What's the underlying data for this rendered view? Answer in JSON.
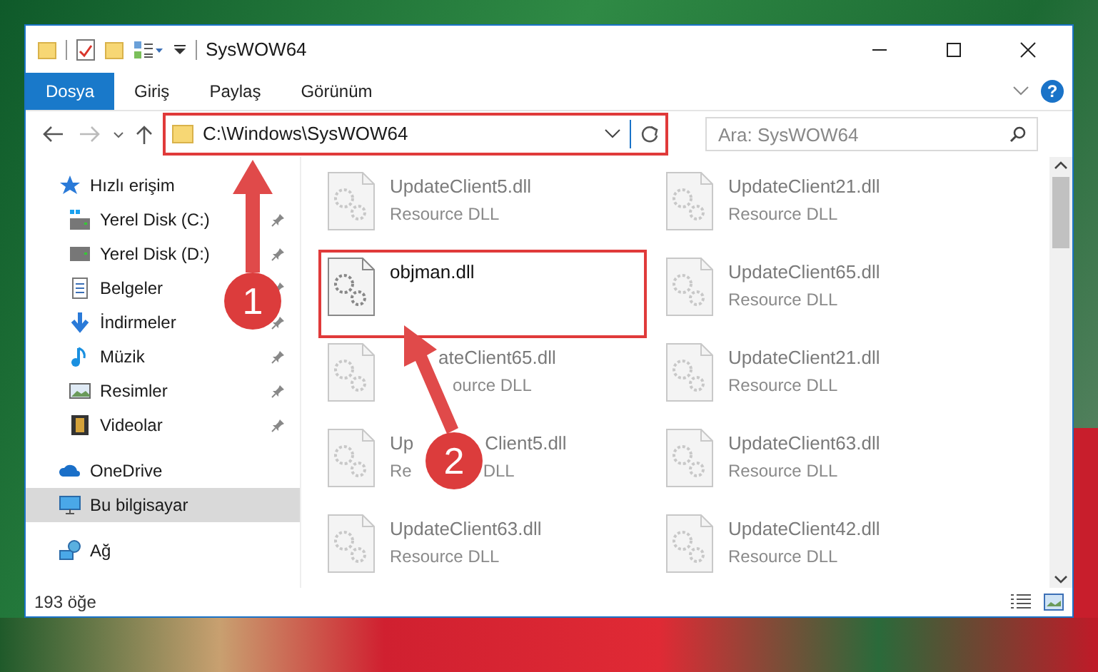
{
  "window": {
    "title": "SysWOW64"
  },
  "ribbon": {
    "tabs": [
      {
        "label": "Dosya",
        "selected": true
      },
      {
        "label": "Giriş",
        "selected": false
      },
      {
        "label": "Paylaş",
        "selected": false
      },
      {
        "label": "Görünüm",
        "selected": false
      }
    ],
    "help_label": "?"
  },
  "address_bar": {
    "path": "C:\\Windows\\SysWOW64",
    "highlighted": true
  },
  "search": {
    "placeholder": "Ara: SysWOW64"
  },
  "sidebar": {
    "items": [
      {
        "label": "Hızlı erişim",
        "kind": "star",
        "selected": false,
        "children": [
          {
            "label": "Yerel Disk (C:)",
            "kind": "drive-win",
            "pinned": true,
            "selected": false
          },
          {
            "label": "Yerel Disk (D:)",
            "kind": "drive",
            "pinned": true,
            "selected": false
          },
          {
            "label": "Belgeler",
            "kind": "doc",
            "pinned": true,
            "selected": false
          },
          {
            "label": "İndirmeler",
            "kind": "download",
            "pinned": true,
            "selected": false
          },
          {
            "label": "Müzik",
            "kind": "music",
            "pinned": true,
            "selected": false
          },
          {
            "label": "Resimler",
            "kind": "picture",
            "pinned": true,
            "selected": false
          },
          {
            "label": "Videolar",
            "kind": "video",
            "pinned": true,
            "selected": false
          }
        ]
      },
      {
        "label": "OneDrive",
        "kind": "cloud",
        "selected": false
      },
      {
        "label": "Bu bilgisayar",
        "kind": "pc",
        "selected": true
      },
      {
        "label": "Ağ",
        "kind": "network",
        "selected": false
      }
    ]
  },
  "files": [
    {
      "kind": "plain",
      "name": "UpdateClient5.dll",
      "type": "Resource DLL",
      "blurred": true,
      "highlighted": false
    },
    {
      "kind": "plain",
      "name": "UpdateClient21.dll",
      "type": "Resource DLL",
      "blurred": true,
      "highlighted": false
    },
    {
      "kind": "plain",
      "name": "objman.dll",
      "blurred": false,
      "highlighted": true
    },
    {
      "kind": "plain",
      "name": "UpdateClient65.dll",
      "type": "Resource DLL",
      "blurred": true,
      "highlighted": false
    },
    {
      "kind": "coveredstart",
      "name": "ateClient65.dll",
      "type": "ource DLL",
      "blurred": true,
      "highlighted": false
    },
    {
      "kind": "plain",
      "name": "UpdateClient21.dll",
      "type": "Resource DLL",
      "blurred": true,
      "highlighted": false
    },
    {
      "kind": "coveredmiddle",
      "name_parts": [
        "Up",
        "Client5.dll"
      ],
      "type_parts": [
        "Re",
        "DLL"
      ],
      "blurred": true,
      "highlighted": false
    },
    {
      "kind": "plain",
      "name": "UpdateClient63.dll",
      "type": "Resource DLL",
      "blurred": true,
      "highlighted": false
    },
    {
      "kind": "plain",
      "name": "UpdateClient63.dll",
      "type": "Resource DLL",
      "blurred": true,
      "highlighted": false
    },
    {
      "kind": "plain",
      "name": "UpdateClient42.dll",
      "type": "Resource DLL",
      "blurred": true,
      "highlighted": false
    }
  ],
  "status_bar": {
    "count": "193 öğe"
  },
  "callouts": [
    {
      "label": "1"
    },
    {
      "label": "2"
    }
  ]
}
